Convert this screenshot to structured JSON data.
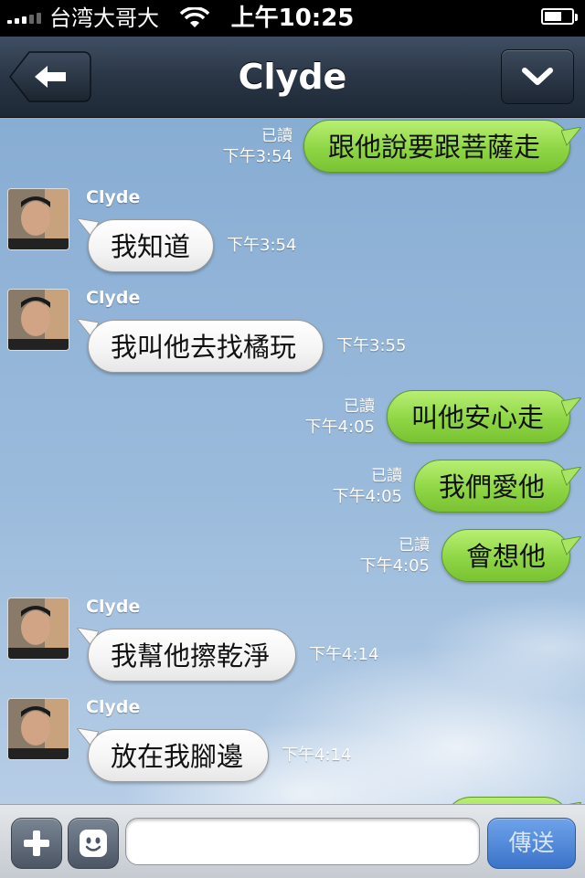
{
  "status_bar": {
    "carrier": "台湾大哥大",
    "time": "上午10:25"
  },
  "nav": {
    "title": "Clyde",
    "back_icon": "back-arrow-icon",
    "menu_icon": "chevron-down-icon"
  },
  "messages": [
    {
      "direction": "out",
      "text": "跟他說要跟菩薩走",
      "read": "已讀",
      "time": "下午3:54"
    },
    {
      "direction": "in",
      "sender": "Clyde",
      "text": "我知道",
      "time": "下午3:54"
    },
    {
      "direction": "in",
      "sender": "Clyde",
      "text": "我叫他去找橘玩",
      "time": "下午3:55"
    },
    {
      "direction": "out",
      "text": "叫他安心走",
      "read": "已讀",
      "time": "下午4:05"
    },
    {
      "direction": "out",
      "text": "我們愛他",
      "read": "已讀",
      "time": "下午4:05"
    },
    {
      "direction": "out",
      "text": "會想他",
      "read": "已讀",
      "time": "下午4:05"
    },
    {
      "direction": "in",
      "sender": "Clyde",
      "text": "我幫他擦乾淨",
      "time": "下午4:14"
    },
    {
      "direction": "in",
      "sender": "Clyde",
      "text": "放在我腳邊",
      "time": "下午4:14"
    }
  ],
  "input_bar": {
    "plus_icon": "plus-icon",
    "sticker_icon": "smiley-icon",
    "placeholder": "",
    "send_label": "傳送"
  },
  "colors": {
    "outgoing_bubble": "#8fd645",
    "incoming_bubble": "#f4f4f4",
    "nav_bar": "#2a3646",
    "send_button": "#3b73c9"
  }
}
